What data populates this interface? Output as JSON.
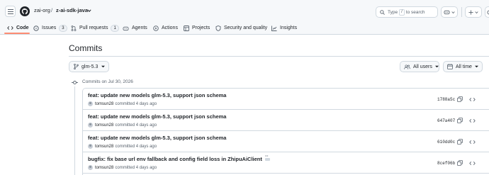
{
  "header": {
    "org": "zai-org",
    "separator": "/",
    "repo": "z-ai-sdk-java",
    "search": {
      "prefix": "Type",
      "shortcut": "/",
      "suffix": "to search"
    }
  },
  "tabs": [
    {
      "label": "Code",
      "icon": "code-icon",
      "active": true
    },
    {
      "label": "Issues",
      "icon": "issue-icon",
      "count": "3"
    },
    {
      "label": "Pull requests",
      "icon": "pull-request-icon",
      "count": "1"
    },
    {
      "label": "Agents",
      "icon": "agents-icon"
    },
    {
      "label": "Actions",
      "icon": "play-icon"
    },
    {
      "label": "Projects",
      "icon": "table-icon"
    },
    {
      "label": "Security and quality",
      "icon": "shield-icon"
    },
    {
      "label": "Insights",
      "icon": "graph-icon"
    }
  ],
  "main": {
    "title": "Commits",
    "branch": "glm-5.3",
    "filters": {
      "users": "All users",
      "time": "All time"
    },
    "group_date": "Commits on Jul 30, 2026",
    "commits": [
      {
        "message": "feat: update new models glm-5.3, support json schema",
        "author": "tomsun28",
        "action": "committed",
        "time": "4 days ago",
        "sha": "1788a5c"
      },
      {
        "message": "feat: update new models glm-5.3, support json schema",
        "author": "tomsun28",
        "action": "committed",
        "time": "4 days ago",
        "sha": "647a407"
      },
      {
        "message": "feat: update new models glm-5.3, support json schema",
        "author": "tomsun28",
        "action": "committed",
        "time": "4 days ago",
        "sha": "610dd0c"
      },
      {
        "message": "bugfix: fix base url env fallback and config field loss in ZhipuAiClient",
        "author": "tomsun28",
        "action": "committed",
        "time": "4 days ago",
        "sha": "8cef06b"
      }
    ]
  },
  "colors": {
    "accent_underline": "#fd8c73",
    "border": "#d1d9e0",
    "muted_text": "#59636e"
  }
}
